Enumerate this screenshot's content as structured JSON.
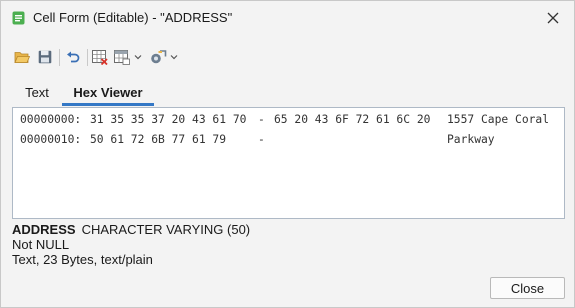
{
  "window": {
    "title": "Cell Form (Editable) - \"ADDRESS\"",
    "accent": "#3478c6",
    "app_icon": "cell-form-icon"
  },
  "toolbar": {
    "icons": [
      "open-folder-icon",
      "save-icon",
      "undo-icon",
      "clear-cell-icon",
      "grid-options-icon",
      "chevron-down-icon",
      "content-type-icon",
      "chevron-down-icon"
    ]
  },
  "tabs": [
    {
      "label": "Text",
      "active": false
    },
    {
      "label": "Hex Viewer",
      "active": true
    }
  ],
  "hex": {
    "rows": [
      {
        "offset": "00000000:",
        "bytes_a": "31 35 35 37 20 43 61 70",
        "sep": "-",
        "bytes_b": "65 20 43 6F 72 61 6C 20",
        "text": "1557 Cape Coral"
      },
      {
        "offset": "00000010:",
        "bytes_a": "50 61 72 6B 77 61 79",
        "sep": "-",
        "bytes_b": "",
        "text": "Parkway"
      }
    ]
  },
  "column": {
    "name": "ADDRESS",
    "type": "CHARACTER VARYING (50)",
    "nullability": "Not NULL",
    "content": "Text, 23 Bytes, text/plain"
  },
  "footer": {
    "close_label": "Close"
  }
}
